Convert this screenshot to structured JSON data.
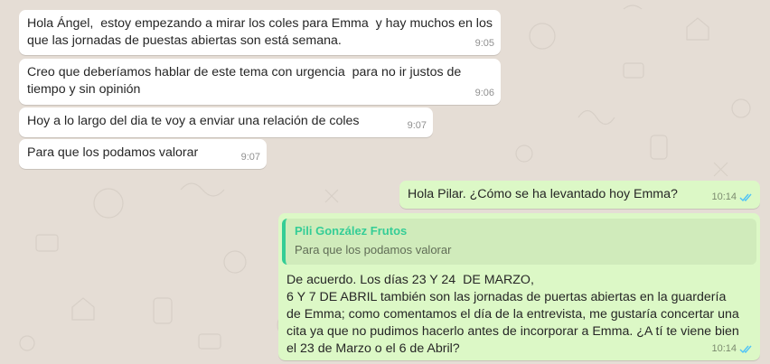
{
  "colors": {
    "background": "#e5ddd5",
    "incoming_bubble": "#ffffff",
    "outgoing_bubble": "#dcf8c6",
    "quote_accent": "#35cd96",
    "read_ticks": "#4fc3f7"
  },
  "messages": [
    {
      "direction": "in",
      "text": "Hola Ángel,  estoy empezando a mirar los coles para Emma  y hay muchos en los que las jornadas de puestas abiertas son está semana.",
      "time": "9:05"
    },
    {
      "direction": "in",
      "text": "Creo que deberíamos hablar de este tema con urgencia  para no ir justos de tiempo y sin opinión",
      "time": "9:06"
    },
    {
      "direction": "in",
      "text": "Hoy a lo largo del dia te voy a enviar una relación de coles",
      "time": "9:07"
    },
    {
      "direction": "in",
      "text": "Para que los podamos valorar",
      "time": "9:07"
    },
    {
      "direction": "out",
      "text": "Hola Pilar. ¿Cómo se ha levantado hoy Emma?",
      "time": "10:14",
      "status_icon": "double-check-read-icon"
    },
    {
      "direction": "out",
      "quote": {
        "author": "Pili González Frutos",
        "text": "Para que los podamos valorar"
      },
      "lines": [
        "De acuerdo. Los días 23 Y 24  DE MARZO,",
        "6 Y 7 DE ABRIL también son las jornadas de puertas abiertas en la guardería",
        "de Emma; como comentamos el día de la entrevista, me gustaría concertar una",
        "cita ya que no pudimos hacerlo antes de incorporar a Emma. ¿A tí te viene bien",
        "el 23 de Marzo o el 6 de Abril?"
      ],
      "time": "10:14",
      "status_icon": "double-check-read-icon"
    }
  ]
}
